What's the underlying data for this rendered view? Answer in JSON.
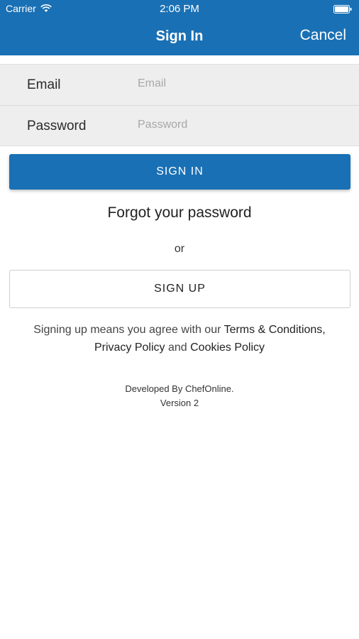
{
  "status_bar": {
    "carrier": "Carrier",
    "time": "2:06 PM",
    "icons": [
      "wifi-icon",
      "battery-icon"
    ]
  },
  "nav": {
    "title": "Sign In",
    "cancel_label": "Cancel"
  },
  "form": {
    "email": {
      "label": "Email",
      "placeholder": "Email",
      "value": ""
    },
    "password": {
      "label": "Password",
      "placeholder": "Password",
      "value": ""
    }
  },
  "actions": {
    "signin_label": "SIGN IN",
    "forgot_label": "Forgot your password",
    "or_text": "or",
    "signup_label": "SIGN UP"
  },
  "terms": {
    "prefix": "Signing up means you agree with our ",
    "terms_link": "Terms & Conditions,",
    "privacy_link": "Privacy Policy",
    "and_text": " and ",
    "cookies_link": "Cookies Policy"
  },
  "footer": {
    "developed_by": "Developed By ChefOnline.",
    "version": "Version 2"
  },
  "colors": {
    "brand": "#1A70B4",
    "form_background": "#EEEEEE",
    "text": "#222222"
  }
}
